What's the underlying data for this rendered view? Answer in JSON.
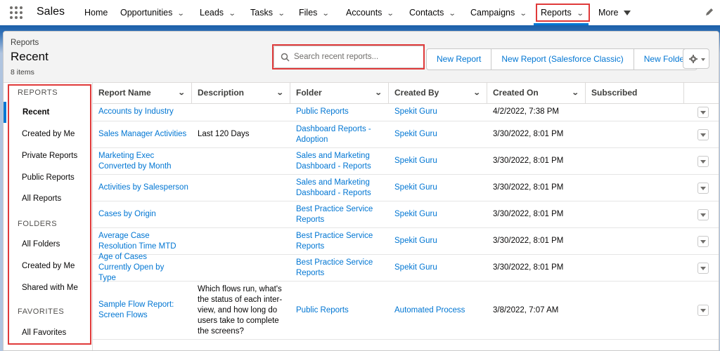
{
  "app": {
    "name": "Sales"
  },
  "nav": {
    "items": [
      {
        "label": "Home",
        "chevron": false
      },
      {
        "label": "Opportunities",
        "chevron": true
      },
      {
        "label": "Leads",
        "chevron": true
      },
      {
        "label": "Tasks",
        "chevron": true
      },
      {
        "label": "Files",
        "chevron": true
      },
      {
        "label": "Accounts",
        "chevron": true
      },
      {
        "label": "Contacts",
        "chevron": true
      },
      {
        "label": "Campaigns",
        "chevron": true
      },
      {
        "label": "Reports",
        "chevron": true,
        "active": true
      },
      {
        "label": "More",
        "chevron": true
      }
    ]
  },
  "header": {
    "breadcrumb": "Reports",
    "title": "Recent",
    "count": "8 items",
    "search_placeholder": "Search recent reports...",
    "buttons": [
      "New Report",
      "New Report (Salesforce Classic)",
      "New Folder"
    ]
  },
  "sidebar": {
    "reports_heading": "REPORTS",
    "reports": [
      "Recent",
      "Created by Me",
      "Private Reports",
      "Public Reports",
      "All Reports"
    ],
    "folders_heading": "FOLDERS",
    "folders": [
      "All Folders",
      "Created by Me",
      "Shared with Me"
    ],
    "favorites_heading": "FAVORITES",
    "favorites": [
      "All Favorites"
    ]
  },
  "table": {
    "columns": [
      "Report Name",
      "Description",
      "Folder",
      "Created By",
      "Created On",
      "Subscribed"
    ],
    "rows": [
      {
        "name": "Accounts by Industry",
        "description": "",
        "folder": "Public Reports",
        "created_by": "Spekit Guru",
        "created_on": "4/2/2022, 7:38 PM"
      },
      {
        "name": "Sales Manager Activities",
        "description": "Last 120 Days",
        "folder": "Dashboard Reports - Adoption",
        "created_by": "Spekit Guru",
        "created_on": "3/30/2022, 8:01 PM"
      },
      {
        "name": "Marketing Exec Converted by Month",
        "description": "",
        "folder": "Sales and Marketing Dashboard - Reports",
        "created_by": "Spekit Guru",
        "created_on": "3/30/2022, 8:01 PM"
      },
      {
        "name": "Activities by Salesperson",
        "description": "",
        "folder": "Sales and Marketing Dashboard - Reports",
        "created_by": "Spekit Guru",
        "created_on": "3/30/2022, 8:01 PM"
      },
      {
        "name": "Cases by Origin",
        "description": "",
        "folder": "Best Practice Service Reports",
        "created_by": "Spekit Guru",
        "created_on": "3/30/2022, 8:01 PM"
      },
      {
        "name": "Average Case Resolution Time MTD",
        "description": "",
        "folder": "Best Practice Service Reports",
        "created_by": "Spekit Guru",
        "created_on": "3/30/2022, 8:01 PM"
      },
      {
        "name": "Age of Cases Currently Open by Type",
        "description": "",
        "folder": "Best Practice Service Reports",
        "created_by": "Spekit Guru",
        "created_on": "3/30/2022, 8:01 PM"
      },
      {
        "name": "Sample Flow Report: Screen Flows",
        "description": "Which flows run, what's the status of each inter-view, and how long do users take to complete the screens?",
        "folder": "Public Reports",
        "created_by": "Automated Process",
        "created_on": "3/8/2022, 7:07 AM"
      }
    ]
  },
  "colors": {
    "link": "#0176d3",
    "highlight": "#e03a3a",
    "accent": "#0176d3"
  }
}
